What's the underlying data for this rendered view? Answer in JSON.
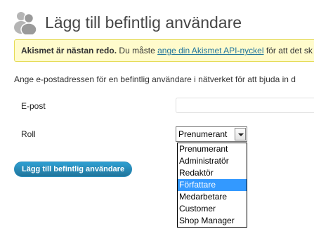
{
  "page": {
    "title": "Lägg till befintlig användare",
    "icon": "users-icon"
  },
  "notice": {
    "bold_text": "Akismet är nästan redo.",
    "text_before_link": " Du måste ",
    "link_text": "ange din Akismet API-nyckel",
    "text_after_link": " för att det sk"
  },
  "form": {
    "intro": "Ange e-postadressen för en befintlig användare i nätverket för att bjuda in d",
    "email_label": "E-post",
    "email_value": "",
    "role_label": "Roll",
    "role_selected": "Prenumerant",
    "role_options": [
      "Prenumerant",
      "Administratör",
      "Redaktör",
      "Författare",
      "Medarbetare",
      "Customer",
      "Shop Manager"
    ],
    "highlighted_option": "Författare",
    "submit_label": "Lägg till befintlig användare"
  },
  "colors": {
    "accent": "#21759b",
    "notice_bg": "#fffbcc",
    "notice_border": "#e6db55",
    "option_highlight": "#3399ff"
  }
}
